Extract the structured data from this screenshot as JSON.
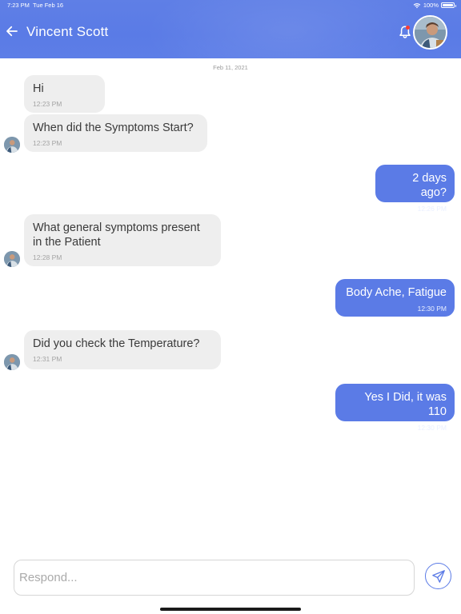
{
  "status_bar": {
    "time": "7:23 PM",
    "date": "Tue Feb 16",
    "battery": "100%"
  },
  "header": {
    "back_icon": "arrow-left-icon",
    "contact_name": "Vincent Scott",
    "bell_icon": "bell-icon",
    "avatar": "contact-avatar"
  },
  "conversation": {
    "date_label": "Feb 11, 2021",
    "messages": [
      {
        "direction": "incoming",
        "text": "Hi",
        "time": "12:23 PM"
      },
      {
        "direction": "incoming",
        "text": "When did the Symptoms Start?",
        "time": "12:23 PM"
      },
      {
        "direction": "outgoing",
        "text": "2 days ago?",
        "time": "12:26 PM"
      },
      {
        "direction": "incoming",
        "text": "What general symptoms present in the Patient",
        "time": "12:28 PM"
      },
      {
        "direction": "outgoing",
        "text": "Body Ache, Fatigue",
        "time": "12:30 PM"
      },
      {
        "direction": "incoming",
        "text": "Did you check the Temperature?",
        "time": "12:31 PM"
      },
      {
        "direction": "outgoing",
        "text": "Yes I Did, it was 110",
        "time": "12:30 PM"
      }
    ]
  },
  "composer": {
    "placeholder": "Respond...",
    "value": "",
    "send_icon": "send-icon"
  },
  "colors": {
    "accent": "#5b7be6",
    "incoming_bubble": "#eeeeee",
    "bell_badge": "#ff3b30"
  }
}
